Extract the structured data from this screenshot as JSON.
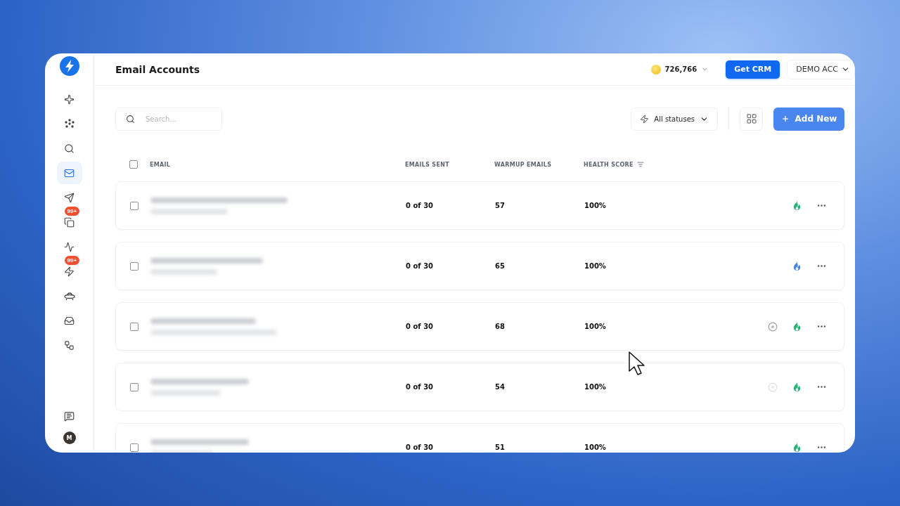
{
  "header": {
    "title": "Email Accounts",
    "credits": "726,766",
    "crm_button": "Get CRM",
    "account": "DEMO ACC"
  },
  "sidebar": {
    "items": [
      {
        "kind": "sparkle",
        "selected": false
      },
      {
        "kind": "dots",
        "selected": false
      },
      {
        "kind": "search",
        "selected": false
      },
      {
        "kind": "mail",
        "selected": true
      },
      {
        "kind": "send",
        "selected": false
      },
      {
        "kind": "copy",
        "selected": false,
        "badge": "99+"
      },
      {
        "kind": "trend",
        "selected": false
      },
      {
        "kind": "bolt",
        "selected": false,
        "badge": "99+"
      },
      {
        "kind": "ufo",
        "selected": false
      },
      {
        "kind": "inbox",
        "selected": false
      },
      {
        "kind": "flow",
        "selected": false
      }
    ],
    "footer": {
      "avatar": "M"
    }
  },
  "toolbar": {
    "search_placeholder": "Search...",
    "filter": "All statuses",
    "add_button": "Add New"
  },
  "table": {
    "header_checked": false,
    "columns": [
      "EMAIL",
      "EMAILS SENT",
      "WARMUP EMAILS",
      "HEALTH SCORE"
    ],
    "rows": [
      {
        "checked": false,
        "emails_sent": "0 of 30",
        "warmup_emails": "57",
        "health_score": "100%",
        "color": "#22b573"
      },
      {
        "checked": false,
        "emails_sent": "0 of 30",
        "warmup_emails": "65",
        "health_score": "100%",
        "color": "#4a86e8"
      },
      {
        "checked": false,
        "emails_sent": "0 of 30",
        "warmup_emails": "68",
        "health_score": "100%",
        "color": "#22b573",
        "status_icon": {
          "dim": false
        }
      },
      {
        "checked": false,
        "emails_sent": "0 of 30",
        "warmup_emails": "54",
        "health_score": "100%",
        "color": "#22b573",
        "status_icon": {
          "dim": true
        }
      },
      {
        "checked": false,
        "emails_sent": "0 of 30",
        "warmup_emails": "51",
        "health_score": "100%",
        "color": "#22b573"
      }
    ]
  }
}
